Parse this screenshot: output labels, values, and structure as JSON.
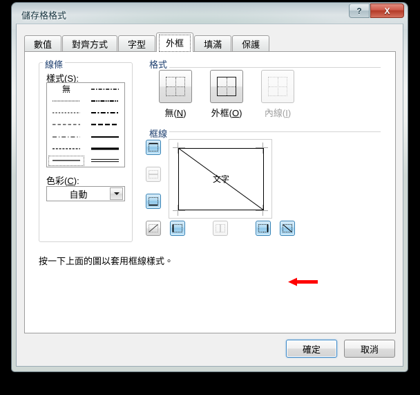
{
  "window": {
    "title": "儲存格格式",
    "caption_buttons": [
      {
        "name": "help",
        "label": "?"
      },
      {
        "name": "close",
        "label": "X"
      }
    ]
  },
  "tabs": [
    {
      "label": "數值",
      "active": false
    },
    {
      "label": "對齊方式",
      "active": false
    },
    {
      "label": "字型",
      "active": false
    },
    {
      "label": "外框",
      "active": true
    },
    {
      "label": "填滿",
      "active": false
    },
    {
      "label": "保護",
      "active": false
    }
  ],
  "lines_group": {
    "title": "線條",
    "style_label": "樣式(S):",
    "style_underline": "S",
    "none_label": "無",
    "styles": [
      {
        "id": "none",
        "column": "left",
        "row": 1,
        "kind": "none",
        "selected": false
      },
      {
        "id": "hairline-dotted",
        "column": "left",
        "row": 2,
        "kind": "dotted-fine",
        "selected": false
      },
      {
        "id": "dashed-fine",
        "column": "left",
        "row": 3,
        "kind": "dashed-fine",
        "selected": false
      },
      {
        "id": "dash-long",
        "column": "left",
        "row": 4,
        "kind": "dash-long",
        "selected": false
      },
      {
        "id": "dash-dot-thin",
        "column": "left",
        "row": 5,
        "kind": "dash-dot-thin",
        "selected": false
      },
      {
        "id": "dash-med",
        "column": "left",
        "row": 6,
        "kind": "dash-med",
        "selected": false
      },
      {
        "id": "solid-thin",
        "column": "left",
        "row": 7,
        "kind": "solid-thin",
        "selected": true
      },
      {
        "id": "dash-dot-thick",
        "column": "right",
        "row": 1,
        "kind": "dash-dot-thick",
        "selected": false
      },
      {
        "id": "dash-dot-dot",
        "column": "right",
        "row": 2,
        "kind": "dash-dot-dot",
        "selected": false
      },
      {
        "id": "dash-dot-2",
        "column": "right",
        "row": 3,
        "kind": "dash-dot-2",
        "selected": false
      },
      {
        "id": "dash-thick",
        "column": "right",
        "row": 4,
        "kind": "dash-thick",
        "selected": false
      },
      {
        "id": "solid-med",
        "column": "right",
        "row": 5,
        "kind": "solid-med",
        "selected": false
      },
      {
        "id": "solid-thick",
        "column": "right",
        "row": 6,
        "kind": "solid-thick",
        "selected": false
      },
      {
        "id": "double",
        "column": "right",
        "row": 7,
        "kind": "double",
        "selected": false
      }
    ],
    "color_label": "色彩(C):",
    "color_underline": "C",
    "color_value": "自動"
  },
  "format_group": {
    "title": "格式",
    "presets": [
      {
        "id": "none",
        "label": "無(N)",
        "underline": "N",
        "state": "enabled",
        "glyph": "dotted-grid"
      },
      {
        "id": "outline",
        "label": "外框(O)",
        "underline": "O",
        "state": "enabled",
        "glyph": "outline-grid"
      },
      {
        "id": "inside",
        "label": "內線(I)",
        "underline": "I",
        "state": "disabled",
        "glyph": "faint-grid"
      }
    ]
  },
  "border_group": {
    "title": "框線",
    "preview": {
      "text": "文字",
      "edges": {
        "top": true,
        "bottom": true,
        "left": true,
        "right": true
      },
      "diagonal_down": true,
      "diagonal_up": false
    },
    "toggles": [
      {
        "id": "top-border",
        "name": "border-top-button",
        "state": "on",
        "position": "left-1"
      },
      {
        "id": "horizontal-inside",
        "name": "border-inside-horizontal-button",
        "state": "disabled",
        "position": "left-2"
      },
      {
        "id": "bottom-border",
        "name": "border-bottom-button",
        "state": "on",
        "position": "left-3"
      },
      {
        "id": "diagonal-up",
        "name": "border-diagonal-up-button",
        "state": "off",
        "position": "bottom-1"
      },
      {
        "id": "left-border",
        "name": "border-left-button",
        "state": "on",
        "position": "bottom-2"
      },
      {
        "id": "vertical-inside",
        "name": "border-inside-vertical-button",
        "state": "disabled",
        "position": "bottom-3"
      },
      {
        "id": "right-border",
        "name": "border-right-button",
        "state": "on",
        "position": "bottom-4"
      },
      {
        "id": "diagonal-down",
        "name": "border-diagonal-down-button",
        "state": "on",
        "position": "bottom-5"
      }
    ],
    "annotation": {
      "type": "arrow",
      "direction": "left",
      "color": "#ff0000",
      "points_at": "diagonal-down"
    }
  },
  "hint_text": "按一下上面的圖以套用框線樣式。",
  "dialog_buttons": [
    {
      "id": "ok",
      "label": "確定",
      "default": true
    },
    {
      "id": "cancel",
      "label": "取消",
      "default": false
    }
  ],
  "colors": {
    "accent": "#3c88c8",
    "toggle_on": "#8ec7ea",
    "annotation": "#ff0000",
    "group_label": "#1b3d6e"
  }
}
